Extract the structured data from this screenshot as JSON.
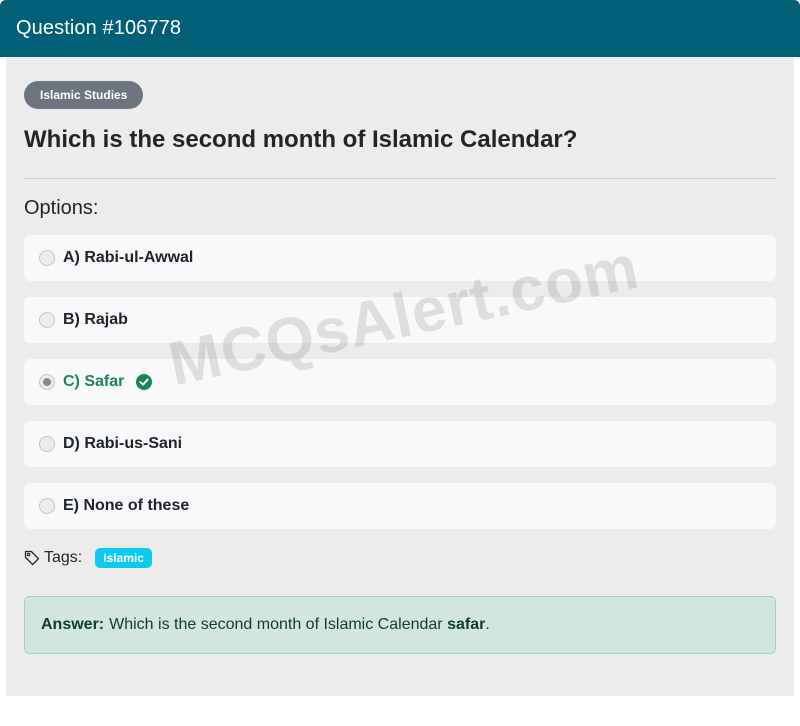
{
  "header": {
    "title": "Question #106778"
  },
  "category": "Islamic Studies",
  "question": "Which is the second month of Islamic Calendar?",
  "options_heading": "Options:",
  "options": [
    {
      "label": "A) Rabi-ul-Awwal",
      "selected": false,
      "correct": false
    },
    {
      "label": "B) Rajab",
      "selected": false,
      "correct": false
    },
    {
      "label": "C) Safar",
      "selected": true,
      "correct": true,
      "icon": "check-circle-icon"
    },
    {
      "label": "D) Rabi-us-Sani",
      "selected": false,
      "correct": false
    },
    {
      "label": "E) None of these",
      "selected": false,
      "correct": false
    }
  ],
  "tags": {
    "label": "Tags:",
    "icon": "tag-icon",
    "items": [
      "Islamic"
    ]
  },
  "answer": {
    "label": "Answer:",
    "text": "Which is the second month of Islamic Calendar",
    "value": "safar",
    "end": "."
  },
  "watermark": "MCQsAlert.com",
  "colors": {
    "header_bg": "#025f78",
    "category_badge": "#6c757d",
    "correct": "#198754",
    "tag_badge": "#0dcaf0",
    "answer_bg": "#d1e7dd"
  }
}
